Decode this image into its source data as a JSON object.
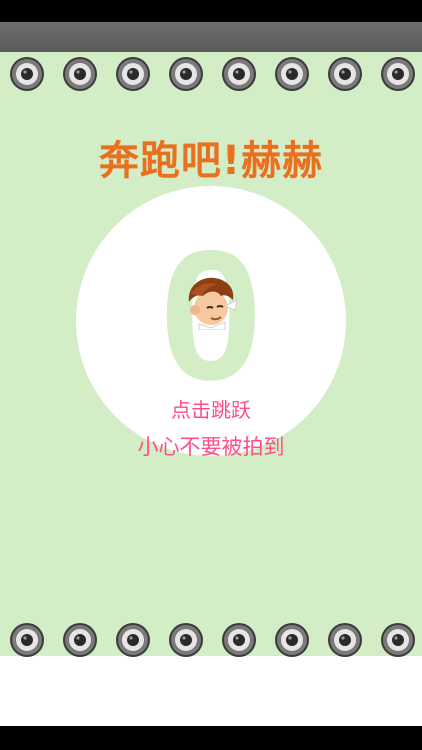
{
  "game": {
    "title": "奔跑吧!赫赫",
    "score": "0",
    "hint_tap": "点击跳跃",
    "hint_warn": "小心不要被拍到",
    "speaker_count": 8
  },
  "colors": {
    "background": "#d3edc6",
    "title": "#e8701f",
    "hint": "#ff4f86",
    "rail": "#636363"
  },
  "icons": {
    "obstacle": "camera-lens-icon",
    "player": "boy-head-icon"
  }
}
